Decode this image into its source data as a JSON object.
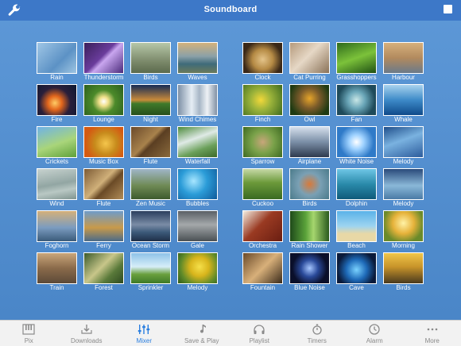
{
  "navbar": {
    "title": "Soundboard"
  },
  "left_tiles": [
    {
      "label": "Rain",
      "bg": "linear-gradient(135deg,#9fc6e6,#5c92c5 60%,#9ec5e2)"
    },
    {
      "label": "Thunderstorm",
      "bg": "linear-gradient(135deg,#3a1f5a,#6a3c9c 45%,#c9a6ef 55%,#4a2a7a)"
    },
    {
      "label": "Birds",
      "bg": "linear-gradient(180deg,#b6c7a8,#7d8b6c 60%,#5b6a4d)"
    },
    {
      "label": "Waves",
      "bg": "linear-gradient(180deg,#d3b27c,#8aa0a8 45%,#3f6b7a 70%,#6b7a5a)"
    },
    {
      "label": "Fire",
      "bg": "radial-gradient(circle at 45% 60%,#ffcc66,#e2661c 25%,#2a1f3a 55%,#0d1830)"
    },
    {
      "label": "Lounge",
      "bg": "radial-gradient(circle at 50% 55%,#ffffff,#f0e08a 18%,#4c8a2a 45%,#2b5e1d)"
    },
    {
      "label": "Night",
      "bg": "linear-gradient(180deg,#142a55,#c98a3a 50%,#3f7a2a 62%,#274f1c)"
    },
    {
      "label": "Wind Chimes",
      "bg": "linear-gradient(90deg,#7d90a6,#e6eef5 35%,#a7b6c6 55%,#eef2f5 75%,#8090a4)"
    },
    {
      "label": "Crickets",
      "bg": "linear-gradient(160deg,#6fb2e8,#a9d57a 55%,#5ea03a)"
    },
    {
      "label": "Music Box",
      "bg": "radial-gradient(circle at 55% 55%,#f5c64c,#c78b1c 40%,#d45a12 75%)"
    },
    {
      "label": "Flute",
      "bg": "linear-gradient(135deg,#6b4a2a,#a8824c 45%,#5a3e22 55%,#8a6a3c)"
    },
    {
      "label": "Waterfall",
      "bg": "linear-gradient(160deg,#4c8a3a,#dfeae6 40%,#6ba05a 70%,#3d6b2a)"
    },
    {
      "label": "Wind",
      "bg": "linear-gradient(170deg,#c7d2cf,#92a6a3 50%,#b9c8c4 70%,#7f948f)"
    },
    {
      "label": "Flute",
      "bg": "linear-gradient(135deg,#7c5a34,#d0b07a 45%,#6a4a26 60%,#b08c58)"
    },
    {
      "label": "Zen Music",
      "bg": "linear-gradient(180deg,#9fb5c8,#6f8a55 55%,#3d5a2e)"
    },
    {
      "label": "Bubbles",
      "bg": "radial-gradient(circle at 40% 40%,#a7e6ff,#2b9cd8 45%,#0f5a9a)"
    },
    {
      "label": "Foghorn",
      "bg": "linear-gradient(180deg,#d4b07a,#7b9cc0 55%,#3a5a7a)"
    },
    {
      "label": "Ferry",
      "bg": "linear-gradient(180deg,#6e9bc9,#c89a4a 55%,#4a6a8a)"
    },
    {
      "label": "Ocean Storm",
      "bg": "linear-gradient(180deg,#2a3e5e,#7a8ca6 45%,#3c5a7a 70%,#1e2e48)"
    },
    {
      "label": "Gale",
      "bg": "linear-gradient(180deg,#5a6066,#a4a8aa 45%,#4a5054)"
    },
    {
      "label": "Train",
      "bg": "linear-gradient(180deg,#c9a67a,#8a6a4a 50%,#5c4a38)"
    },
    {
      "label": "Forest",
      "bg": "linear-gradient(135deg,#3b5a2a,#c8c68a 45%,#5a7a3a 70%,#2e4a20)"
    },
    {
      "label": "Sprinkler",
      "bg": "linear-gradient(180deg,#8ec2e8,#d6eef8 45%,#6aa03e 70%,#3f7a26)"
    },
    {
      "label": "Melody",
      "bg": "radial-gradient(circle at 55% 45%,#f5e04a,#d8b51c 35%,#5e8a2a 70%,#2e5a1a)"
    }
  ],
  "right_tiles": [
    {
      "label": "Clock",
      "bg": "radial-gradient(circle at 50% 55%,#e4c48a,#b58a44 40%,#3a2818 75%)"
    },
    {
      "label": "Cat Purring",
      "bg": "linear-gradient(135deg,#b59a7c,#e6d8c6 45%,#8a7258)"
    },
    {
      "label": "Grasshoppers",
      "bg": "linear-gradient(160deg,#2e6a1c,#7cc23a 50%,#1f4f14)"
    },
    {
      "label": "Harbour",
      "bg": "linear-gradient(180deg,#d6b07c,#b28a5e 50%,#6a7a8a)"
    },
    {
      "label": "Finch",
      "bg": "radial-gradient(circle at 45% 50%,#f2d83a,#9ab23a 40%,#3e6a1e)"
    },
    {
      "label": "Owl",
      "bg": "radial-gradient(circle at 50% 45%,#e6a52a,#7a5a2a 40%,#1e3a12 80%)"
    },
    {
      "label": "Fan",
      "bg": "radial-gradient(circle at 50% 50%,#c8e6e6,#6aa6b8 35%,#1e4a5a 75%)"
    },
    {
      "label": "Whale",
      "bg": "linear-gradient(180deg,#a8d2ee,#3d8ac8 50%,#0f4a8a)"
    },
    {
      "label": "Sparrow",
      "bg": "radial-gradient(circle at 50% 50%,#c8a67a,#7aa24a 45%,#3e6a22)"
    },
    {
      "label": "Airplane",
      "bg": "linear-gradient(180deg,#d6e0ec,#7a8ea6 50%,#2e3a4e)"
    },
    {
      "label": "White Noise",
      "bg": "radial-gradient(circle at 50% 50%,#ffffff,#9fd2ff 30%,#2f7ac8 70%)"
    },
    {
      "label": "Melody",
      "bg": "linear-gradient(160deg,#1f4e8a,#7ab2e0 45%,#2c5c9c)"
    },
    {
      "label": "Cuckoo",
      "bg": "linear-gradient(180deg,#c6d8a6,#6c9a3a 45%,#3a6a22)"
    },
    {
      "label": "Birds",
      "bg": "radial-gradient(circle at 50% 50%,#d87a3a,#7aa0b4 45%,#4a7a8a)"
    },
    {
      "label": "Dolphin",
      "bg": "linear-gradient(180deg,#6ec6e6,#2a8aaa 50%,#0f5a7a)"
    },
    {
      "label": "Melody",
      "bg": "linear-gradient(180deg,#2a4a7a,#8ab8d8 55%,#4a7aa6)"
    },
    {
      "label": "Orchestra",
      "bg": "linear-gradient(135deg,#f2ece0,#9a3a22 45%,#6a1e12)"
    },
    {
      "label": "Rain Shower",
      "bg": "linear-gradient(90deg,#1e4a1a,#5aa23a 40%,#a6d66e 60%,#2a5a1e)"
    },
    {
      "label": "Beach",
      "bg": "linear-gradient(180deg,#5ab2e8,#9ed4f0 50%,#e8d8a6 75%)"
    },
    {
      "label": "Morning",
      "bg": "radial-gradient(circle at 50% 40%,#fff2a6,#e6b23a 40%,#6a8a2a 75%)"
    },
    {
      "label": "Fountain",
      "bg": "linear-gradient(135deg,#6a4a2a,#d8b07a 50%,#3a2a1a)"
    },
    {
      "label": "Blue Noise",
      "bg": "radial-gradient(circle at 50% 50%,#a6c6ff,#2a4a9a 35%,#0a0f2a 70%)"
    },
    {
      "label": "Cave",
      "bg": "radial-gradient(circle at 50% 55%,#7ad2ff,#1e6ab8 40%,#0a1a3a 75%)"
    },
    {
      "label": "Birds",
      "bg": "linear-gradient(180deg,#f0c64a,#c8942a 45%,#4a3a1e)"
    }
  ],
  "tabbar": {
    "tabs": [
      {
        "label": "Pix",
        "icon": "piano-icon",
        "active": false
      },
      {
        "label": "Downloads",
        "icon": "downloads-icon",
        "active": false
      },
      {
        "label": "Mixer",
        "icon": "mixer-icon",
        "active": true
      },
      {
        "label": "Save & Play",
        "icon": "music-note-icon",
        "active": false
      },
      {
        "label": "Playlist",
        "icon": "headphones-icon",
        "active": false
      },
      {
        "label": "Timers",
        "icon": "stopwatch-icon",
        "active": false
      },
      {
        "label": "Alarm",
        "icon": "clock-icon",
        "active": false
      },
      {
        "label": "More",
        "icon": "more-icon",
        "active": false
      }
    ],
    "active_color": "#2b7fe0",
    "inactive_color": "#8a8a8a"
  }
}
